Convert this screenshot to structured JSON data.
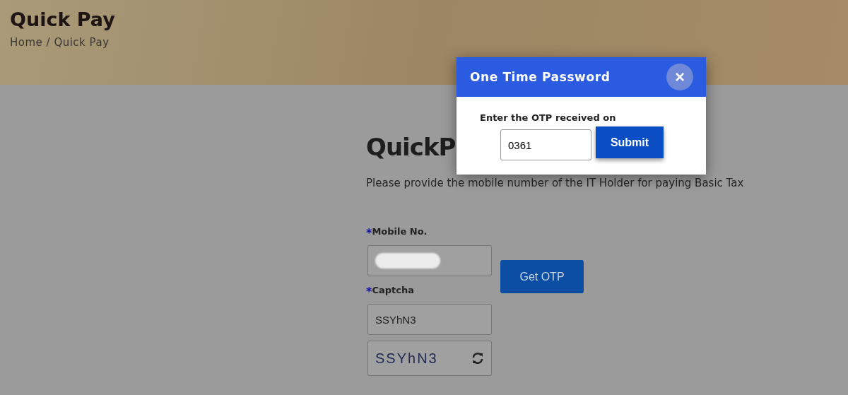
{
  "banner": {
    "title": "Quick Pay",
    "breadcrumb": "Home / Quick Pay"
  },
  "form": {
    "heading": "QuickP",
    "description": "Please provide the mobile number of the IT Holder for paying Basic Tax",
    "fields": [
      {
        "kind": "redacted",
        "label": "Mobile No.",
        "required_mark": "*"
      },
      {
        "kind": "text",
        "label": "Captcha",
        "required_mark": "*",
        "value": "SSYhN3"
      },
      {
        "kind": "captcha",
        "captcha_text": "SSYhN3"
      }
    ],
    "button": "Get OTP"
  },
  "modal": {
    "title": "One Time Password",
    "close": "×",
    "prompt": "Enter the OTP received on",
    "otp_value": "0361",
    "submit": "Submit"
  }
}
